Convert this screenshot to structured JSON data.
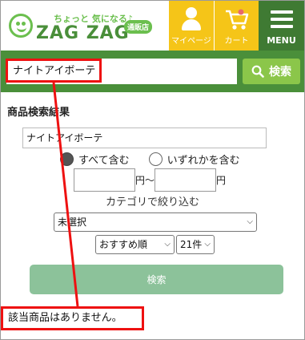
{
  "header": {
    "logo_tagline": "ちょっと 気になる♪",
    "logo_name": "ZAG ZAG",
    "logo_badge": "通販店",
    "nav": [
      {
        "label": "マイページ",
        "icon": "person-icon"
      },
      {
        "label": "カート",
        "icon": "cart-icon"
      },
      {
        "label": "MENU",
        "icon": "hamburger-menu-icon"
      }
    ],
    "colors": {
      "brand_green": "#4a8f3a",
      "nav_yellow": "#f5c518",
      "accent_green": "#8bc64a"
    }
  },
  "search": {
    "value": "ナイトアイボーテ",
    "button_label": "検索",
    "button_icon": "search-icon"
  },
  "results": {
    "title": "商品検索結果",
    "keyword_value": "ナイトアイボーテ",
    "radio_all_label": "すべて含む",
    "radio_any_label": "いずれかを含む",
    "radio_selected": "すべて含む",
    "price_from_suffix": "円～",
    "price_to_suffix": "円",
    "price_from_value": "",
    "price_to_value": "",
    "refine_label": "カテゴリで絞り込む",
    "category_selected": "未選択",
    "sort_selected": "おすすめ順",
    "count_selected": "21件",
    "submit_label": "検索",
    "no_result_message": "該当商品はありません。"
  },
  "annotation": {
    "color": "#e11111"
  }
}
